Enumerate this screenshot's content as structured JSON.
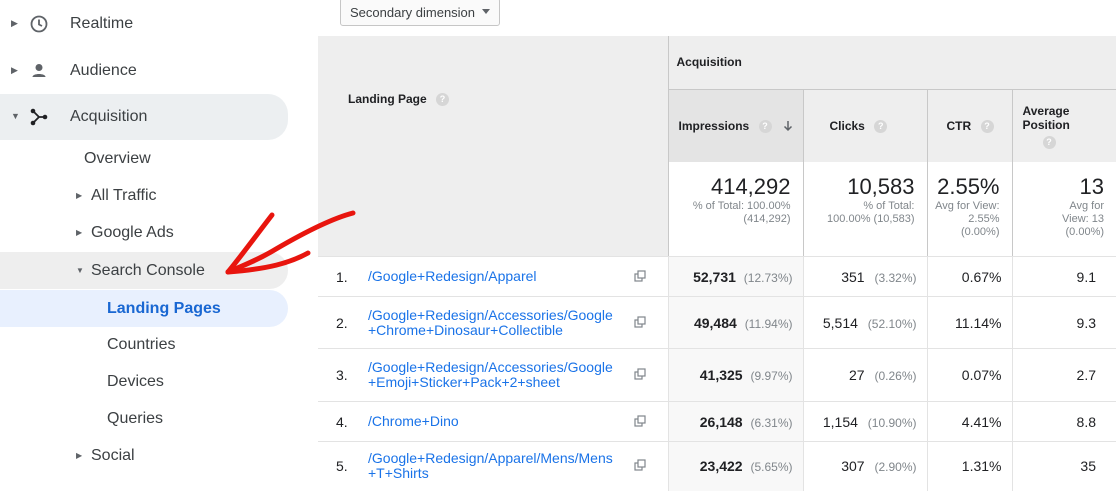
{
  "sidebar": {
    "top_items": [
      {
        "label": "Realtime",
        "icon": "clock-icon"
      },
      {
        "label": "Audience",
        "icon": "person-icon"
      },
      {
        "label": "Acquisition",
        "icon": "acquisition-icon"
      }
    ],
    "acquisition_items": [
      {
        "label": "Overview"
      },
      {
        "label": "All Traffic"
      },
      {
        "label": "Google Ads"
      },
      {
        "label": "Search Console"
      }
    ],
    "search_console_items": [
      {
        "label": "Landing Pages"
      },
      {
        "label": "Countries"
      },
      {
        "label": "Devices"
      },
      {
        "label": "Queries"
      }
    ],
    "after_items": [
      {
        "label": "Social"
      }
    ]
  },
  "toolbar": {
    "secondary_dimension_label": "Secondary dimension"
  },
  "table": {
    "group_header": "Acquisition",
    "columns": {
      "landing_page": "Landing Page",
      "impressions": "Impressions",
      "clicks": "Clicks",
      "ctr": "CTR",
      "avg_position": "Average Position"
    },
    "help_glyph": "?",
    "totals": {
      "impressions": {
        "value": "414,292",
        "line1": "% of Total: 100.00%",
        "line2": "(414,292)"
      },
      "clicks": {
        "value": "10,583",
        "line1": "% of Total:",
        "line2": "100.00% (10,583)"
      },
      "ctr": {
        "value": "2.55%",
        "line1": "Avg for View:",
        "line2": "2.55%",
        "line3": "(0.00%)"
      },
      "avg_position": {
        "value": "13",
        "line1": "Avg for",
        "line2": "View: 13",
        "line3": "(0.00%)"
      }
    },
    "rows": [
      {
        "index": "1.",
        "page_line1": "/Google+Redesign/Apparel",
        "page_line2": "",
        "impressions": "52,731",
        "impressions_pct": "(12.73%)",
        "clicks": "351",
        "clicks_pct": "(3.32%)",
        "ctr": "0.67%",
        "avg_position": "9.1"
      },
      {
        "index": "2.",
        "page_line1": "/Google+Redesign/Accessories/Google",
        "page_line2": "+Chrome+Dinosaur+Collectible",
        "impressions": "49,484",
        "impressions_pct": "(11.94%)",
        "clicks": "5,514",
        "clicks_pct": "(52.10%)",
        "ctr": "11.14%",
        "avg_position": "9.3"
      },
      {
        "index": "3.",
        "page_line1": "/Google+Redesign/Accessories/Google",
        "page_line2": "+Emoji+Sticker+Pack+2+sheet",
        "impressions": "41,325",
        "impressions_pct": "(9.97%)",
        "clicks": "27",
        "clicks_pct": "(0.26%)",
        "ctr": "0.07%",
        "avg_position": "2.7"
      },
      {
        "index": "4.",
        "page_line1": "/Chrome+Dino",
        "page_line2": "",
        "impressions": "26,148",
        "impressions_pct": "(6.31%)",
        "clicks": "1,154",
        "clicks_pct": "(10.90%)",
        "ctr": "4.41%",
        "avg_position": "8.8"
      },
      {
        "index": "5.",
        "page_line1": "/Google+Redesign/Apparel/Mens/Mens",
        "page_line2": "+T+Shirts",
        "impressions": "23,422",
        "impressions_pct": "(5.65%)",
        "clicks": "307",
        "clicks_pct": "(2.90%)",
        "ctr": "1.31%",
        "avg_position": "35"
      }
    ]
  },
  "colors": {
    "accent_blue": "#1a73e8",
    "annotation_red": "#e8150e",
    "header_gray": "#eeeeee"
  }
}
